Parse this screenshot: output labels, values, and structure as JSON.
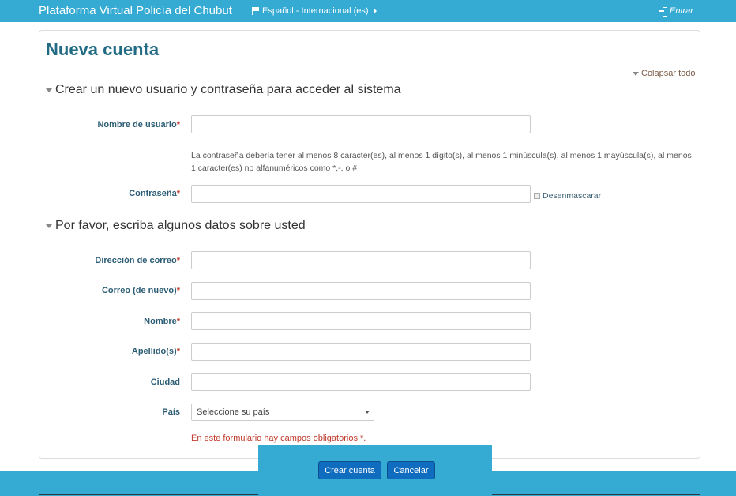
{
  "navbar": {
    "brand": "Plataforma Virtual Policía del Chubut",
    "language": "Español - Internacional (es)",
    "login": "Entrar"
  },
  "page": {
    "title": "Nueva cuenta",
    "collapse_all": "Colapsar todo"
  },
  "section1": {
    "heading": "Crear un nuevo usuario y contraseña para acceder al sistema",
    "username_label": "Nombre de usuario",
    "password_help": "La contraseña debería tener al menos 8 caracter(es), al menos 1 dígito(s), al menos 1 minúscula(s), al menos 1 mayúscula(s), al menos 1 caracter(es) no alfanuméricos como *,-, o #",
    "password_label": "Contraseña",
    "unmask_label": "Desenmascarar"
  },
  "section2": {
    "heading": "Por favor, escriba algunos datos sobre usted",
    "email_label": "Dirección de correo",
    "email2_label": "Correo (de nuevo)",
    "firstname_label": "Nombre",
    "lastname_label": "Apellido(s)",
    "city_label": "Ciudad",
    "country_label": "País",
    "country_selected": "Seleccione su país"
  },
  "form": {
    "required_marker": "*",
    "required_note": "En este formulario hay campos obligatorios *.",
    "submit_label": "Crear cuenta",
    "cancel_label": "Cancelar"
  }
}
